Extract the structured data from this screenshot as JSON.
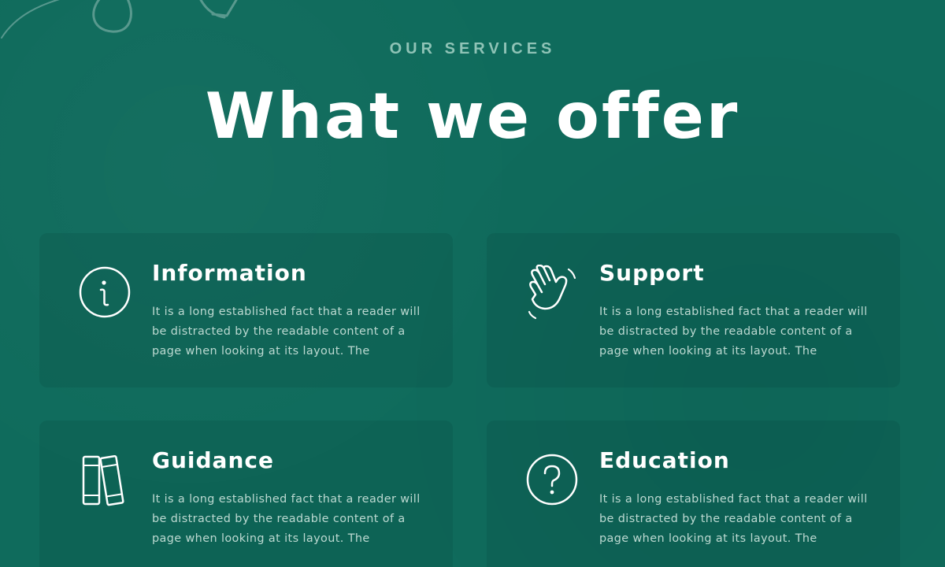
{
  "header": {
    "eyebrow": "OUR SERVICES",
    "title": "What we offer"
  },
  "colors": {
    "background": "#0f6b5c",
    "eyebrow": "#8fc3b6",
    "body_text": "#bcd9d1"
  },
  "services": [
    {
      "title": "Information",
      "icon": "info-icon",
      "description": "It is a long established fact that a reader will be distracted by the readable content of a page when looking at its layout. The"
    },
    {
      "title": "Support",
      "icon": "waving-hand-icon",
      "description": "It is a long established fact that a reader will be distracted by the readable content of a page when looking at its layout. The"
    },
    {
      "title": "Guidance",
      "icon": "books-icon",
      "description": "It is a long established fact that a reader will be distracted by the readable content of a page when looking at its layout. The"
    },
    {
      "title": "Education",
      "icon": "question-icon",
      "description": "It is a long established fact that a reader will be distracted by the readable content of a page when looking at its layout. The"
    }
  ]
}
